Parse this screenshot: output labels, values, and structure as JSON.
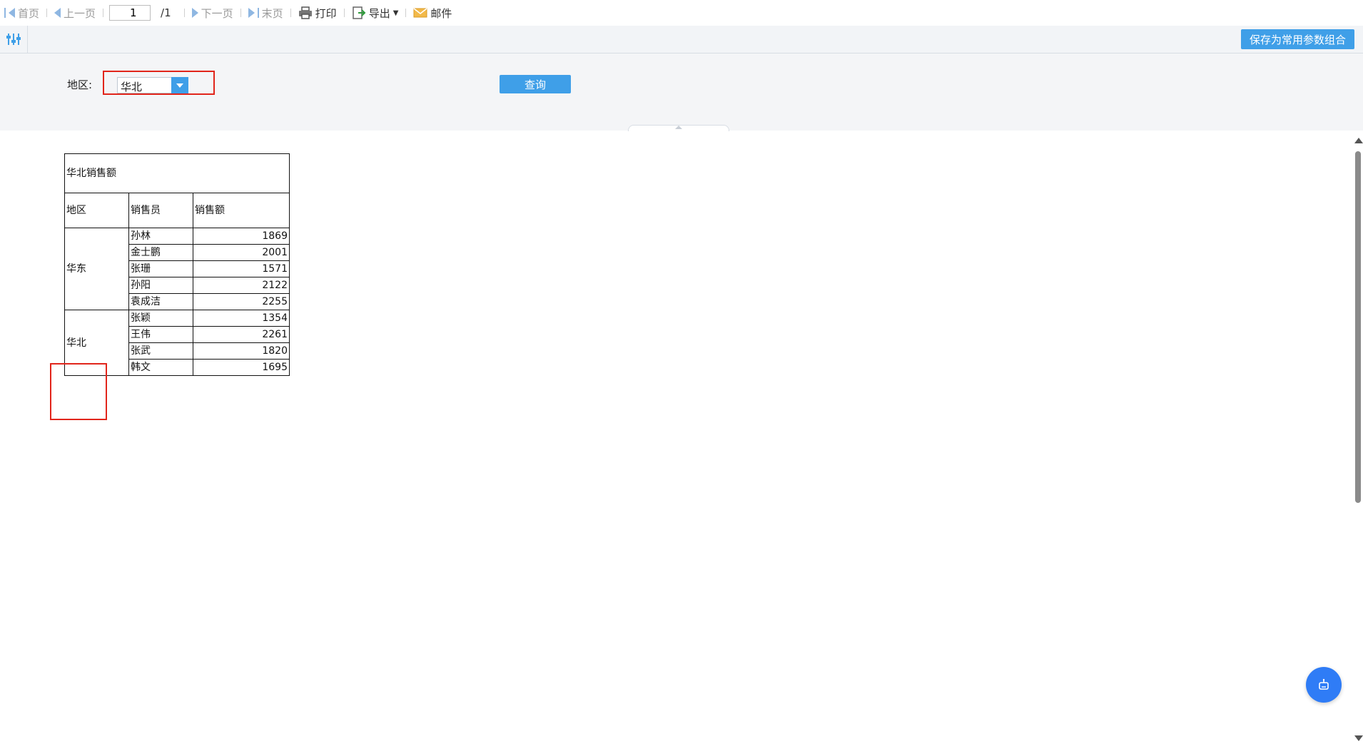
{
  "toolbar": {
    "first_label": "首页",
    "prev_label": "上一页",
    "page_value": "1",
    "total_pages": "/1",
    "next_label": "下一页",
    "last_label": "末页",
    "print_label": "打印",
    "export_label": "导出",
    "mail_label": "邮件"
  },
  "param_bar": {
    "save_label": "保存为常用参数组合"
  },
  "params": {
    "region_label": "地区:",
    "region_value": "华北",
    "query_label": "查询"
  },
  "report": {
    "title": "华北销售额",
    "headers": [
      "地区",
      "销售员",
      "销售额"
    ],
    "groups": [
      {
        "region": "华东",
        "rows": [
          {
            "salesperson": "孙林",
            "amount": "1869"
          },
          {
            "salesperson": "金士鹏",
            "amount": "2001"
          },
          {
            "salesperson": "张珊",
            "amount": "1571"
          },
          {
            "salesperson": "孙阳",
            "amount": "2122"
          },
          {
            "salesperson": "袁成洁",
            "amount": "2255"
          }
        ]
      },
      {
        "region": "华北",
        "rows": [
          {
            "salesperson": "张颖",
            "amount": "1354"
          },
          {
            "salesperson": "王伟",
            "amount": "2261"
          },
          {
            "salesperson": "张武",
            "amount": "1820"
          },
          {
            "salesperson": "韩文",
            "amount": "1695"
          }
        ]
      }
    ]
  },
  "colors": {
    "accent": "#3f9fe8",
    "highlight": "#e1251b",
    "assistant": "#2f7cf6"
  }
}
